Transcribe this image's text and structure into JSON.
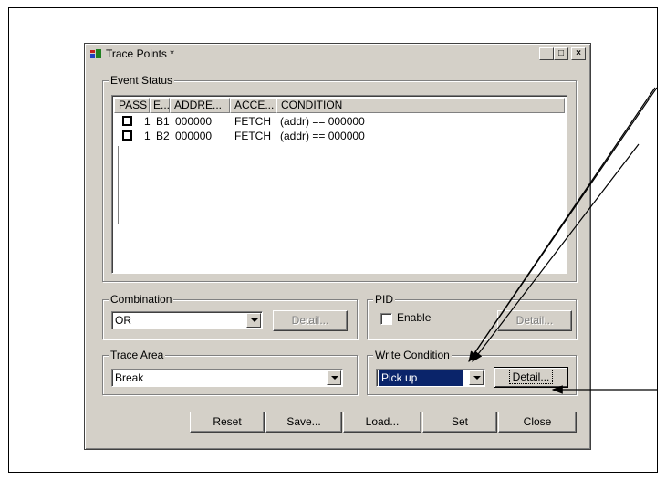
{
  "window": {
    "title": "Trace Points *",
    "minimize_label": "_",
    "maximize_label": "□",
    "close_label": "×"
  },
  "event_status": {
    "label": "Event Status",
    "columns": [
      "PASS",
      "E...",
      "ADDRE...",
      "ACCE...",
      "CONDITION"
    ],
    "rows": [
      {
        "pass": "1",
        "event": "B1",
        "address": "000000",
        "access": "FETCH",
        "condition": "(addr) == 000000"
      },
      {
        "pass": "1",
        "event": "B2",
        "address": "000000",
        "access": "FETCH",
        "condition": "(addr) == 000000"
      }
    ]
  },
  "combination": {
    "label": "Combination",
    "value": "OR",
    "detail_label": "Detail..."
  },
  "pid": {
    "label": "PID",
    "enable_label": "Enable",
    "enabled": false,
    "detail_label": "Detail..."
  },
  "trace_area": {
    "label": "Trace Area",
    "value": "Break"
  },
  "write_condition": {
    "label": "Write Condition",
    "value": "Pick up",
    "detail_label": "Detail..."
  },
  "buttons": {
    "reset": "Reset",
    "save": "Save...",
    "load": "Load...",
    "set": "Set",
    "close": "Close"
  },
  "colors": {
    "dialog_bg": "#d4d0c8",
    "selection": "#0a246a"
  }
}
